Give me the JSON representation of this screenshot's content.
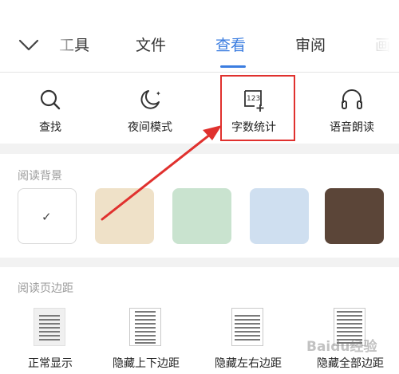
{
  "tabs": {
    "items": [
      {
        "label": "工具",
        "active": false
      },
      {
        "label": "文件",
        "active": false
      },
      {
        "label": "查看",
        "active": true
      },
      {
        "label": "审阅",
        "active": false
      },
      {
        "label": "画笔",
        "active": false
      }
    ],
    "accent_color": "#3b7de0"
  },
  "tools": {
    "find": {
      "label": "查找",
      "icon": "search-icon"
    },
    "night": {
      "label": "夜间模式",
      "icon": "moon-icon"
    },
    "count": {
      "label": "字数统计",
      "icon": "word-count-icon",
      "icon_text": "123"
    },
    "read": {
      "label": "语音朗读",
      "icon": "headphones-icon"
    }
  },
  "annotation": {
    "highlight_color": "#e0312e"
  },
  "background": {
    "title": "阅读背景",
    "swatches": [
      {
        "name": "white",
        "color": "#ffffff",
        "selected": true
      },
      {
        "name": "beige",
        "color": "#efe1c8",
        "selected": false
      },
      {
        "name": "green",
        "color": "#c9e3cf",
        "selected": false
      },
      {
        "name": "blue",
        "color": "#cfdff0",
        "selected": false
      },
      {
        "name": "brown",
        "color": "#5b4538",
        "selected": false
      }
    ],
    "check": "✓"
  },
  "margins": {
    "title": "阅读页边距",
    "items": [
      {
        "label": "正常显示",
        "selected": true
      },
      {
        "label": "隐藏上下边距",
        "selected": false
      },
      {
        "label": "隐藏左右边距",
        "selected": false
      },
      {
        "label": "隐藏全部边距",
        "selected": false
      }
    ]
  },
  "watermark": "Baidu经验"
}
